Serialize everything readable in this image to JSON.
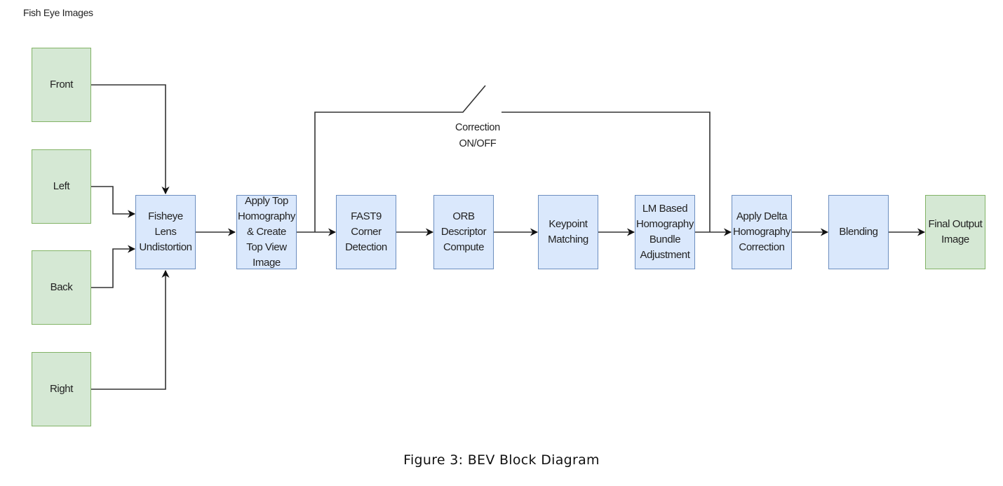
{
  "header": {
    "title": "Fish Eye Images"
  },
  "inputs": [
    {
      "id": "front",
      "label": "Front"
    },
    {
      "id": "left",
      "label": "Left"
    },
    {
      "id": "back",
      "label": "Back"
    },
    {
      "id": "right",
      "label": "Right"
    }
  ],
  "pipeline": [
    {
      "id": "fisheye",
      "label": "Fisheye\nLens\nUndistortion"
    },
    {
      "id": "tophomo",
      "label": "Apply Top\nHomography\n& Create\nTop View\nImage"
    },
    {
      "id": "fast9",
      "label": "FAST9\nCorner\nDetection"
    },
    {
      "id": "orb",
      "label": "ORB\nDescriptor\nCompute"
    },
    {
      "id": "keypoint",
      "label": "Keypoint\nMatching"
    },
    {
      "id": "lm",
      "label": "LM Based\nHomography\nBundle\nAdjustment"
    },
    {
      "id": "delta",
      "label": "Apply Delta\nHomography\nCorrection"
    },
    {
      "id": "blending",
      "label": "Blending"
    },
    {
      "id": "output",
      "label": "Final Output\nImage"
    }
  ],
  "switch": {
    "label": "Correction\nON/OFF"
  },
  "caption": "Figure 3: BEV Block Diagram",
  "colors": {
    "input_fill": "#d5e8d4",
    "input_stroke": "#82b366",
    "process_fill": "#dae8fc",
    "process_stroke": "#6c8ebf",
    "wire": "#333333"
  }
}
